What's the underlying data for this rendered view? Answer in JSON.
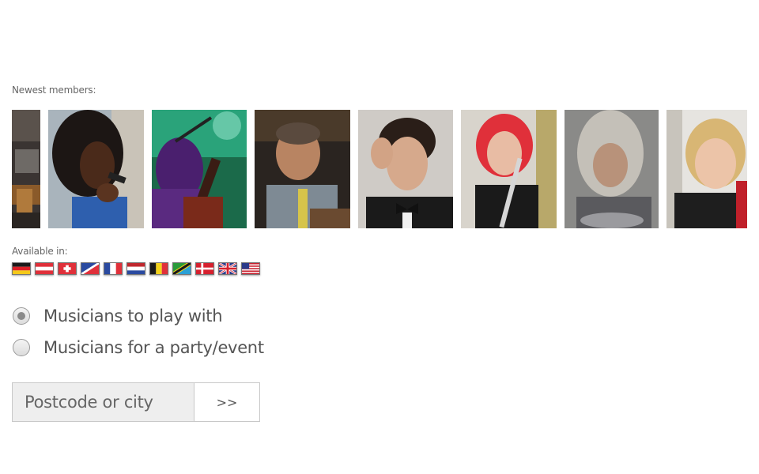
{
  "newest_members": {
    "label": "Newest members:",
    "photos": [
      {
        "name": "member-photo-1"
      },
      {
        "name": "member-photo-2"
      },
      {
        "name": "member-photo-3"
      },
      {
        "name": "member-photo-4"
      },
      {
        "name": "member-photo-5"
      },
      {
        "name": "member-photo-6"
      },
      {
        "name": "member-photo-7"
      },
      {
        "name": "member-photo-8"
      }
    ]
  },
  "available_in": {
    "label": "Available in:",
    "flags": [
      "germany-flag",
      "austria-flag",
      "switzerland-flag",
      "luxembourg-flag",
      "france-flag",
      "netherlands-flag",
      "belgium-flag",
      "tanzania-flag",
      "denmark-flag",
      "uk-flag",
      "usa-flag"
    ]
  },
  "search_type": {
    "options": [
      {
        "label": "Musicians to play with",
        "checked": true
      },
      {
        "label": "Musicians for a party/event",
        "checked": false
      }
    ]
  },
  "search": {
    "placeholder": "Postcode or city",
    "value": "",
    "button_label": ">>"
  },
  "colors": {
    "text": "#555555",
    "input_bg": "#eeeeee",
    "border": "#c8c8c8"
  }
}
